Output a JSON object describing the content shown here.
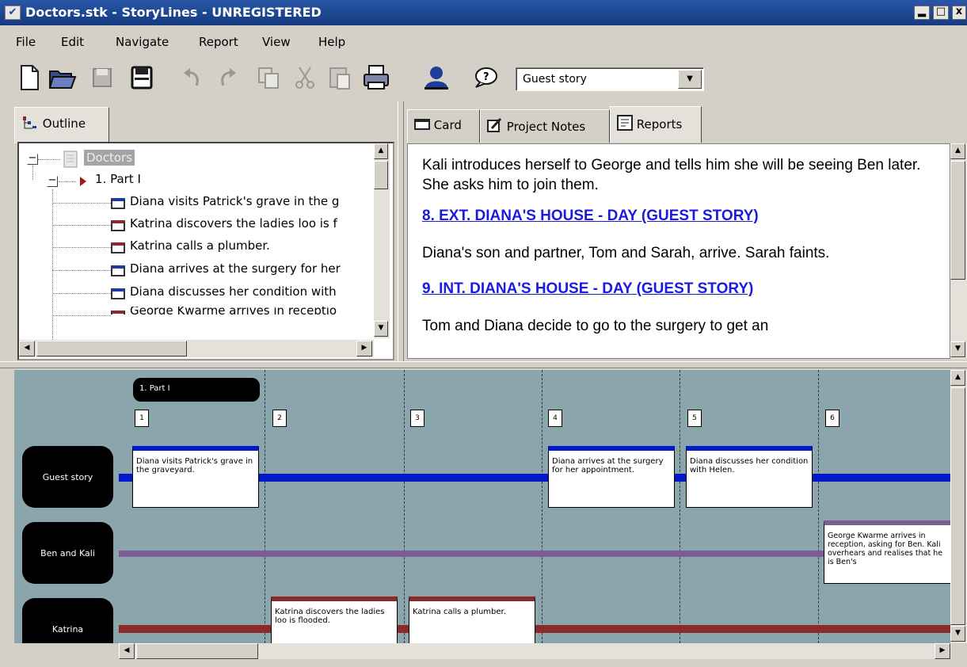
{
  "window": {
    "title": "Doctors.stk - StoryLines - UNREGISTERED",
    "sysmenu_glyph": "✔",
    "minimize_glyph": "▂",
    "maximize_glyph": "□",
    "close_glyph": "x"
  },
  "menu": [
    "File",
    "Edit",
    "Navigate",
    "Report",
    "View",
    "Help"
  ],
  "toolbar": {
    "icons": [
      "new-icon",
      "open-icon",
      "save-icon",
      "save-as-icon",
      "undo-icon",
      "redo-icon",
      "copy-icon",
      "cut-icon",
      "paste-icon",
      "print-icon",
      "characters-icon",
      "help-icon"
    ],
    "storyline_select": "Guest story",
    "combo_arrow": "▼"
  },
  "outline": {
    "tab_label": "Outline",
    "root": "Doctors",
    "part": "1. Part I",
    "items": [
      "Diana visits Patrick's grave in the g",
      "Katrina discovers the ladies loo is f",
      "Katrina calls a plumber.",
      "Diana arrives at the surgery for her",
      "Diana discusses her condition with",
      "George Kwarme arrives in receptio"
    ],
    "expander": "−"
  },
  "right_tabs": [
    "Card",
    "Project Notes",
    "Reports"
  ],
  "report": {
    "p1": "Kali introduces herself to George and tells him she will be seeing Ben later. She asks him to join them.",
    "h8": "8. EXT. DIANA'S HOUSE - DAY (GUEST STORY)",
    "p2": "Diana's son and partner, Tom and Sarah, arrive. Sarah faints.",
    "h9": "9. INT. DIANA'S HOUSE - DAY (GUEST STORY)",
    "p3": "Tom and Diana decide to go to the surgery to get an"
  },
  "storyline": {
    "part_label": "1. Part I",
    "tracks": [
      "Guest story",
      "Ben and Kali",
      "Katrina"
    ],
    "scene_numbers": [
      "1",
      "2",
      "3",
      "4",
      "5",
      "6"
    ],
    "cards": {
      "c1": "Diana visits Patrick's grave in the graveyard.",
      "c2": "Katrina discovers the ladies loo is flooded.",
      "c3": "Katrina calls a plumber.",
      "c4": "Diana arrives at the surgery for her appointment.",
      "c5": "Diana discusses her condition with Helen.",
      "c6": "George Kwarme arrives in reception, asking for Ben. Kali overhears and realises that he is Ben's"
    },
    "colors": {
      "guest": "#0019c8",
      "ben": "#8a6aa0",
      "katrina": "#8b2a2a",
      "background": "#8aa5ab"
    }
  },
  "scroll": {
    "up": "▲",
    "down": "▼",
    "left": "◀",
    "right": "▶"
  }
}
